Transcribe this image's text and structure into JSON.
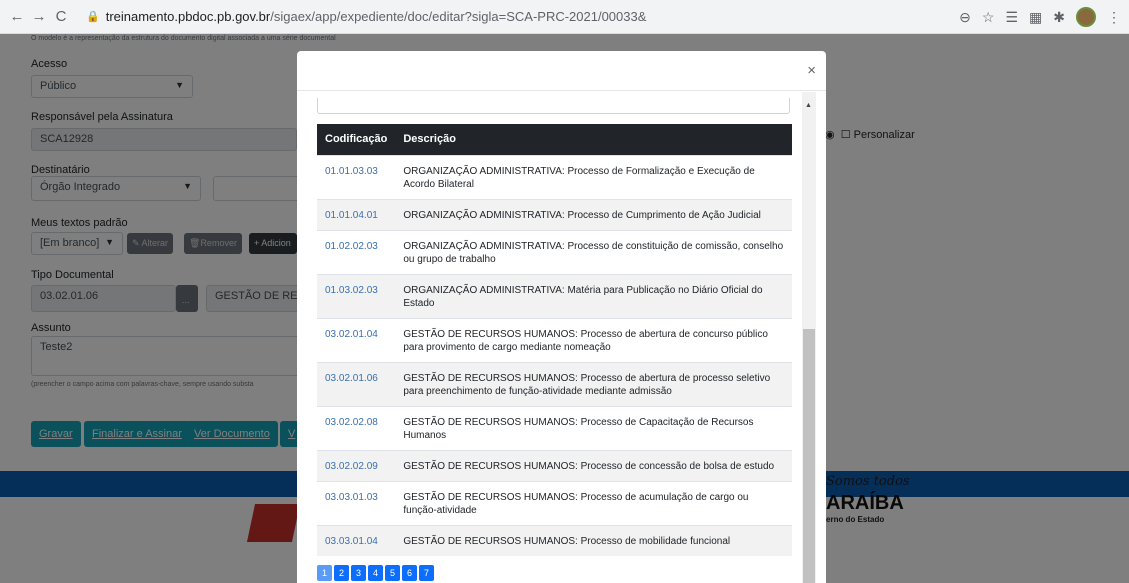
{
  "browser": {
    "url_host": "treinamento.pbdoc.pb.gov.br",
    "url_path": "/sigaex/app/expediente/doc/editar?sigla=SCA-PRC-2021/00033&"
  },
  "form": {
    "hint_top": "O modelo é a representação da estrutura do documento digital associada a uma série documental",
    "acesso_label": "Acesso",
    "acesso_value": "Público",
    "responsavel_label": "Responsável pela Assinatura",
    "responsavel_value": "SCA12928",
    "personalizar_label": "Personalizar",
    "destinatario_label": "Destinatário",
    "destinatario_value": "Órgão Integrado",
    "textos_label": "Meus textos padrão",
    "textos_value": "[Em branco]",
    "alterar": "Alterar",
    "remover": "Remover",
    "adicionar": "+ Adicion",
    "tipo_label": "Tipo Documental",
    "tipo_code": "03.02.01.06",
    "tipo_btn": "...",
    "tipo_desc": "GESTÃO DE RECU",
    "assunto_label": "Assunto",
    "assunto_value": "Teste2",
    "assunto_hint": "(preencher o campo acima com palavras-chave, sempre usando substa",
    "gravar": "Gravar",
    "finalizar": "Finalizar e Assinar",
    "ver_documento": "Ver Documento",
    "extra_btn": "V"
  },
  "footer": {
    "script": "Somos todos",
    "brand": "ARAÍBA",
    "sub": "erno do Estado"
  },
  "modal": {
    "close": "×",
    "columns": [
      "Codificação",
      "Descrição"
    ],
    "rows": [
      {
        "code": "01.01.03.03",
        "desc": "ORGANIZAÇÃO ADMINISTRATIVA: Processo de Formalização e Execução de Acordo Bilateral"
      },
      {
        "code": "01.01.04.01",
        "desc": "ORGANIZAÇÃO ADMINISTRATIVA: Processo de Cumprimento de Ação Judicial"
      },
      {
        "code": "01.02.02.03",
        "desc": "ORGANIZAÇÃO ADMINISTRATIVA: Processo de constituição de comissão, conselho ou grupo de trabalho"
      },
      {
        "code": "01.03.02.03",
        "desc": "ORGANIZAÇÃO ADMINISTRATIVA: Matéria para Publicação no Diário Oficial do Estado"
      },
      {
        "code": "03.02.01.04",
        "desc": "GESTÃO DE RECURSOS HUMANOS: Processo de abertura de concurso público para provimento de cargo mediante nomeação"
      },
      {
        "code": "03.02.01.06",
        "desc": "GESTÃO DE RECURSOS HUMANOS: Processo de abertura de processo seletivo para preenchimento de função-atividade mediante admissão"
      },
      {
        "code": "03.02.02.08",
        "desc": "GESTÃO DE RECURSOS HUMANOS: Processo de Capacitação de Recursos Humanos"
      },
      {
        "code": "03.02.02.09",
        "desc": "GESTÃO DE RECURSOS HUMANOS: Processo de concessão de bolsa de estudo"
      },
      {
        "code": "03.03.01.03",
        "desc": "GESTÃO DE RECURSOS HUMANOS: Processo de acumulação de cargo ou função-atividade"
      },
      {
        "code": "03.03.01.04",
        "desc": "GESTÃO DE RECURSOS HUMANOS: Processo de mobilidade funcional"
      }
    ],
    "pages": [
      "1",
      "2",
      "3",
      "4",
      "5",
      "6",
      "7"
    ]
  }
}
